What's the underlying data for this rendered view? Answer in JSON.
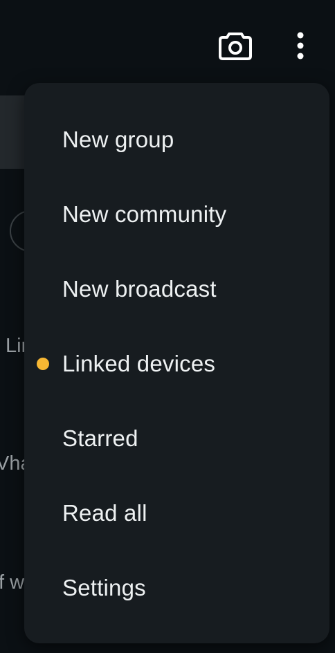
{
  "colors": {
    "background": "#0b1014",
    "menu_background": "#171c20",
    "menu_text": "#eef1f2",
    "indicator_dot": "#f7b733",
    "icon": "#ffffff"
  },
  "topbar": {
    "camera_icon": "camera-icon",
    "menu_icon": "more-vertical-icon"
  },
  "background": {
    "fragment_1": "Lir",
    "fragment_2": "Vha",
    "fragment_3": "f w"
  },
  "menu": {
    "items": [
      {
        "label": "New group",
        "dot": false
      },
      {
        "label": "New community",
        "dot": false
      },
      {
        "label": "New broadcast",
        "dot": false
      },
      {
        "label": "Linked devices",
        "dot": true
      },
      {
        "label": "Starred",
        "dot": false
      },
      {
        "label": "Read all",
        "dot": false
      },
      {
        "label": "Settings",
        "dot": false
      }
    ]
  }
}
